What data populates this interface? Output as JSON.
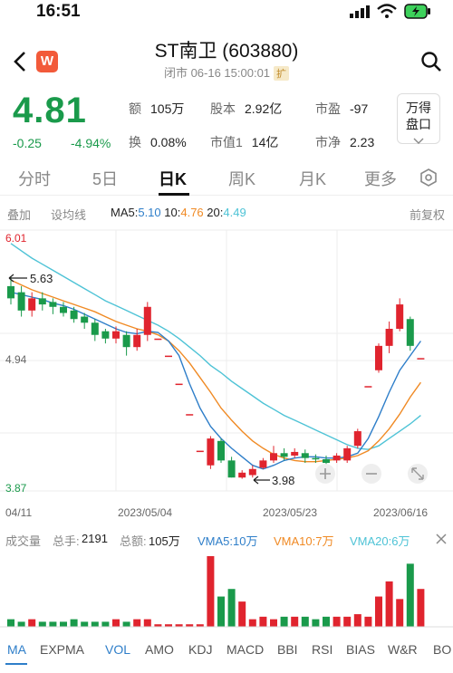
{
  "status": {
    "time": "16:51"
  },
  "header": {
    "title": "ST南卫 (603880)",
    "subtitle": "闭市 06-16 15:00:01",
    "badge": "扩",
    "app_badge": "W"
  },
  "quote": {
    "price": "4.81",
    "change": "-0.25",
    "change_pct": "-4.94%",
    "stats": [
      {
        "label": "额",
        "value": "105万"
      },
      {
        "label": "股本",
        "value": "2.92亿"
      },
      {
        "label": "市盈",
        "value": "-97"
      },
      {
        "label": "换",
        "value": "0.08%"
      },
      {
        "label": "市值1",
        "value": "14亿"
      },
      {
        "label": "市净",
        "value": "2.23"
      }
    ],
    "wande_line1": "万得",
    "wande_line2": "盘口"
  },
  "tabs": [
    "分时",
    "5日",
    "日K",
    "周K",
    "月K",
    "更多"
  ],
  "active_tab": "日K",
  "toolbar": {
    "overlay": "叠加",
    "trendline": "设均线",
    "ma5_label": "MA5:",
    "ma5": "5.10",
    "ma10_label": "10:",
    "ma10": "4.76",
    "ma20_label": "20:",
    "ma20": "4.49",
    "adjust": "前复权"
  },
  "price_axis": {
    "top": "6.01",
    "mid": "4.94",
    "bottom": "3.87"
  },
  "annotations": {
    "high": "5.63",
    "low": "3.98"
  },
  "dates": {
    "start": "04/11",
    "d1": "2023/05/04",
    "d2": "2023/05/23",
    "d3": "2023/06/16"
  },
  "volume": {
    "label": "成交量",
    "total_hands_label": "总手:",
    "total_hands": "2191",
    "total_amount_label": "总额:",
    "total_amount": "105万",
    "vma5": "VMA5:10万",
    "vma10": "VMA10:7万",
    "vma20": "VMA20:6万"
  },
  "indicator_tabs": [
    "MA",
    "EXPMA",
    "VOL",
    "AMO",
    "KDJ",
    "MACD",
    "BBI",
    "RSI",
    "BIAS",
    "W&R",
    "BO"
  ],
  "colors": {
    "up": "#e0242e",
    "down": "#1a9a4b",
    "ma5": "#2e7ec9",
    "ma10": "#f08a24",
    "ma20": "#4ec3d6"
  },
  "chart_data": {
    "type": "candlestick",
    "ylim": [
      3.87,
      6.01
    ],
    "candles": [
      {
        "o": 5.55,
        "c": 5.45,
        "h": 5.63,
        "l": 5.4
      },
      {
        "o": 5.5,
        "c": 5.35,
        "h": 5.55,
        "l": 5.3
      },
      {
        "o": 5.35,
        "c": 5.45,
        "h": 5.5,
        "l": 5.3
      },
      {
        "o": 5.45,
        "c": 5.4,
        "h": 5.5,
        "l": 5.35
      },
      {
        "o": 5.42,
        "c": 5.38,
        "h": 5.45,
        "l": 5.32
      },
      {
        "o": 5.38,
        "c": 5.33,
        "h": 5.42,
        "l": 5.3
      },
      {
        "o": 5.35,
        "c": 5.28,
        "h": 5.38,
        "l": 5.25
      },
      {
        "o": 5.3,
        "c": 5.25,
        "h": 5.33,
        "l": 5.2
      },
      {
        "o": 5.25,
        "c": 5.15,
        "h": 5.28,
        "l": 5.1
      },
      {
        "o": 5.18,
        "c": 5.12,
        "h": 5.2,
        "l": 5.08
      },
      {
        "o": 5.12,
        "c": 5.18,
        "h": 5.22,
        "l": 5.08
      },
      {
        "o": 5.15,
        "c": 5.05,
        "h": 5.18,
        "l": 4.98
      },
      {
        "o": 5.05,
        "c": 5.15,
        "h": 5.2,
        "l": 5.02
      },
      {
        "o": 5.15,
        "c": 5.38,
        "h": 5.42,
        "l": 5.1
      },
      {
        "o": 5.12,
        "c": 5.12,
        "h": 5.12,
        "l": 5.12
      },
      {
        "o": 4.98,
        "c": 4.98,
        "h": 4.98,
        "l": 4.98
      },
      {
        "o": 4.75,
        "c": 4.75,
        "h": 4.75,
        "l": 4.75
      },
      {
        "o": 4.5,
        "c": 4.5,
        "h": 4.5,
        "l": 4.5
      },
      {
        "o": 4.2,
        "c": 4.2,
        "h": 4.2,
        "l": 4.2
      },
      {
        "o": 4.08,
        "c": 4.3,
        "h": 4.32,
        "l": 4.05
      },
      {
        "o": 4.28,
        "c": 4.12,
        "h": 4.3,
        "l": 4.1
      },
      {
        "o": 4.12,
        "c": 3.98,
        "h": 4.15,
        "l": 3.98
      },
      {
        "o": 3.98,
        "c": 4.02,
        "h": 4.04,
        "l": 3.97
      },
      {
        "o": 4.0,
        "c": 4.05,
        "h": 4.08,
        "l": 3.98
      },
      {
        "o": 4.06,
        "c": 4.12,
        "h": 4.14,
        "l": 4.05
      },
      {
        "o": 4.12,
        "c": 4.18,
        "h": 4.24,
        "l": 4.1
      },
      {
        "o": 4.18,
        "c": 4.15,
        "h": 4.22,
        "l": 4.12
      },
      {
        "o": 4.16,
        "c": 4.19,
        "h": 4.22,
        "l": 4.14
      },
      {
        "o": 4.18,
        "c": 4.14,
        "h": 4.21,
        "l": 4.1
      },
      {
        "o": 4.14,
        "c": 4.13,
        "h": 4.17,
        "l": 4.1
      },
      {
        "o": 4.13,
        "c": 4.1,
        "h": 4.16,
        "l": 4.05
      },
      {
        "o": 4.12,
        "c": 4.16,
        "h": 4.18,
        "l": 4.1
      },
      {
        "o": 4.12,
        "c": 4.22,
        "h": 4.24,
        "l": 4.1
      },
      {
        "o": 4.24,
        "c": 4.36,
        "h": 4.38,
        "l": 4.22
      },
      {
        "o": 4.73,
        "c": 4.73,
        "h": 4.73,
        "l": 4.73
      },
      {
        "o": 4.86,
        "c": 5.06,
        "h": 5.08,
        "l": 4.84
      },
      {
        "o": 5.06,
        "c": 5.2,
        "h": 5.26,
        "l": 5.0
      },
      {
        "o": 5.2,
        "c": 5.4,
        "h": 5.45,
        "l": 5.18
      },
      {
        "o": 5.28,
        "c": 5.06,
        "h": 5.3,
        "l": 5.02
      },
      {
        "o": 4.96,
        "c": 4.96,
        "h": 4.96,
        "l": 4.96
      }
    ],
    "volumes": [
      3,
      2,
      3,
      2,
      2,
      2,
      3,
      2,
      2,
      2,
      3,
      2,
      3,
      3,
      1,
      1,
      1,
      1,
      1,
      28,
      12,
      15,
      10,
      3,
      4,
      3,
      4,
      4,
      4,
      3,
      4,
      4,
      4,
      5,
      4,
      12,
      18,
      11,
      25,
      15
    ],
    "ma5": [
      5.5,
      5.48,
      5.46,
      5.44,
      5.41,
      5.39,
      5.36,
      5.32,
      5.28,
      5.24,
      5.2,
      5.17,
      5.16,
      5.18,
      5.17,
      5.1,
      4.98,
      4.75,
      4.55,
      4.4,
      4.3,
      4.22,
      4.15,
      4.08,
      4.05,
      4.08,
      4.12,
      4.14,
      4.15,
      4.15,
      4.14,
      4.14,
      4.15,
      4.18,
      4.3,
      4.48,
      4.68,
      4.86,
      4.98,
      5.1
    ],
    "ma10": [
      5.6,
      5.56,
      5.52,
      5.49,
      5.46,
      5.43,
      5.4,
      5.37,
      5.34,
      5.3,
      5.26,
      5.23,
      5.2,
      5.18,
      5.15,
      5.1,
      5.02,
      4.92,
      4.8,
      4.68,
      4.55,
      4.45,
      4.36,
      4.28,
      4.22,
      4.17,
      4.14,
      4.12,
      4.11,
      4.11,
      4.12,
      4.13,
      4.14,
      4.16,
      4.2,
      4.28,
      4.38,
      4.5,
      4.64,
      4.76
    ],
    "ma20": [
      5.9,
      5.84,
      5.78,
      5.73,
      5.68,
      5.63,
      5.58,
      5.53,
      5.48,
      5.43,
      5.39,
      5.35,
      5.31,
      5.27,
      5.23,
      5.18,
      5.12,
      5.05,
      4.98,
      4.9,
      4.84,
      4.77,
      4.71,
      4.65,
      4.59,
      4.54,
      4.49,
      4.45,
      4.41,
      4.37,
      4.33,
      4.29,
      4.25,
      4.22,
      4.21,
      4.24,
      4.3,
      4.36,
      4.42,
      4.49
    ]
  }
}
